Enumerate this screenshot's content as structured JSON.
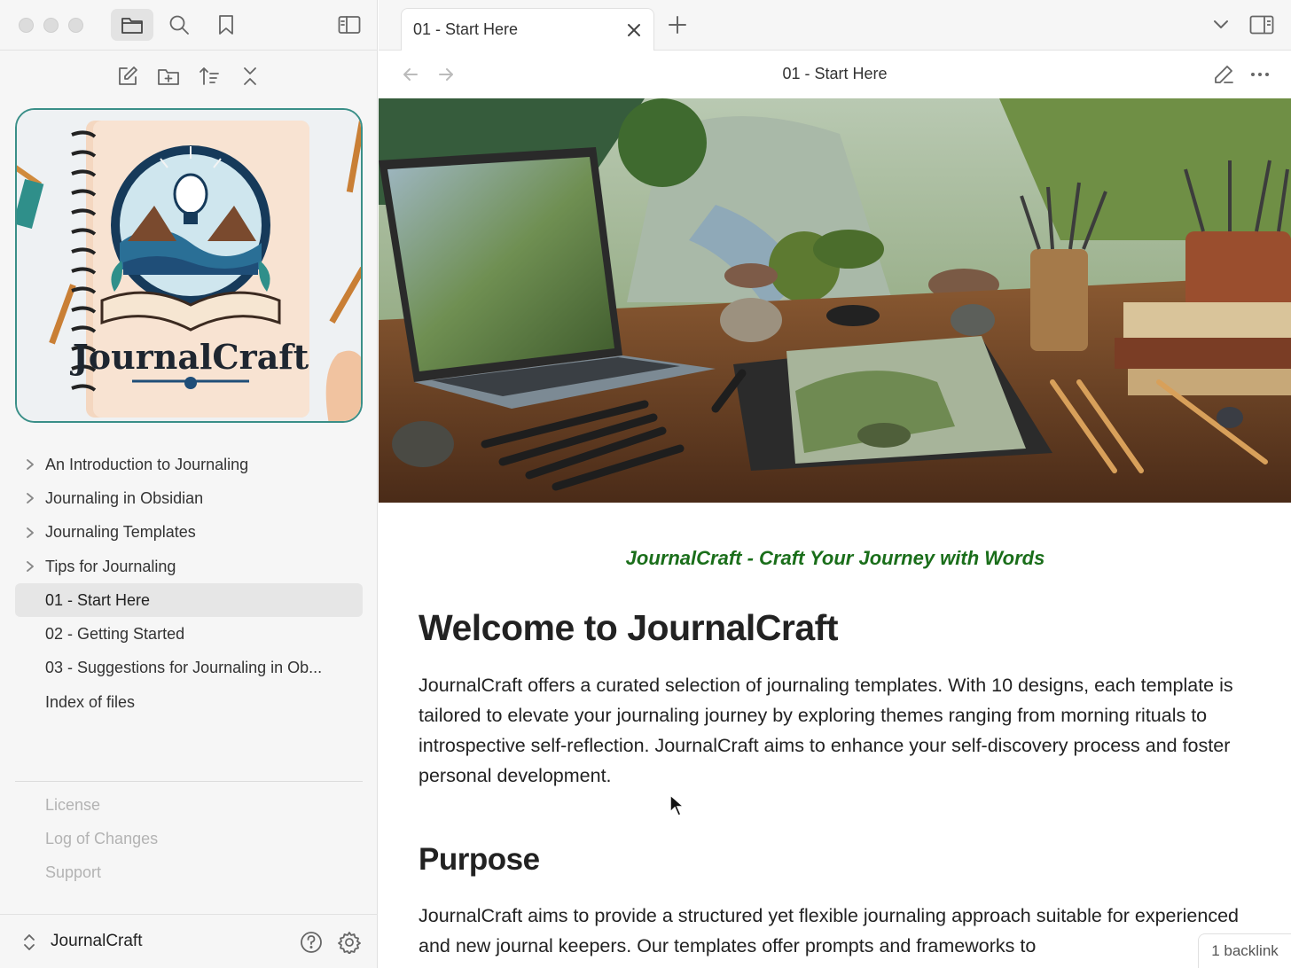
{
  "sidebar": {
    "tree": [
      {
        "label": "An Introduction to Journaling",
        "folder": true
      },
      {
        "label": "Journaling in Obsidian",
        "folder": true
      },
      {
        "label": "Journaling Templates",
        "folder": true
      },
      {
        "label": "Tips for Journaling",
        "folder": true
      },
      {
        "label": "01 - Start Here",
        "folder": false,
        "active": true
      },
      {
        "label": "02 - Getting Started",
        "folder": false
      },
      {
        "label": "03 - Suggestions for Journaling in Ob...",
        "folder": false
      },
      {
        "label": "Index of files",
        "folder": false
      }
    ],
    "footer_links": [
      "License",
      "Log of Changes",
      "Support"
    ],
    "vault_name": "JournalCraft",
    "cover_logo_text": "JournalCraft"
  },
  "tabs": [
    {
      "title": "01 - Start Here",
      "active": true
    }
  ],
  "view": {
    "title": "01 - Start Here"
  },
  "note": {
    "tagline": "JournalCraft - Craft Your Journey with Words",
    "heading_welcome": "Welcome to JournalCraft",
    "paragraph_welcome": "JournalCraft offers a curated selection of journaling templates. With 10 designs, each template is tailored to elevate your journaling journey by exploring themes ranging from morning rituals to introspective self-reflection. JournalCraft aims to enhance your self-discovery process and foster personal development.",
    "heading_purpose": "Purpose",
    "paragraph_purpose": "JournalCraft aims to provide a structured yet flexible journaling approach suitable for experienced and new journal keepers. Our templates offer prompts and frameworks to"
  },
  "status": {
    "backlinks": "1 backlink"
  },
  "colors": {
    "accent_teal": "#3a8f88",
    "tagline_green": "#1a6e1a"
  }
}
